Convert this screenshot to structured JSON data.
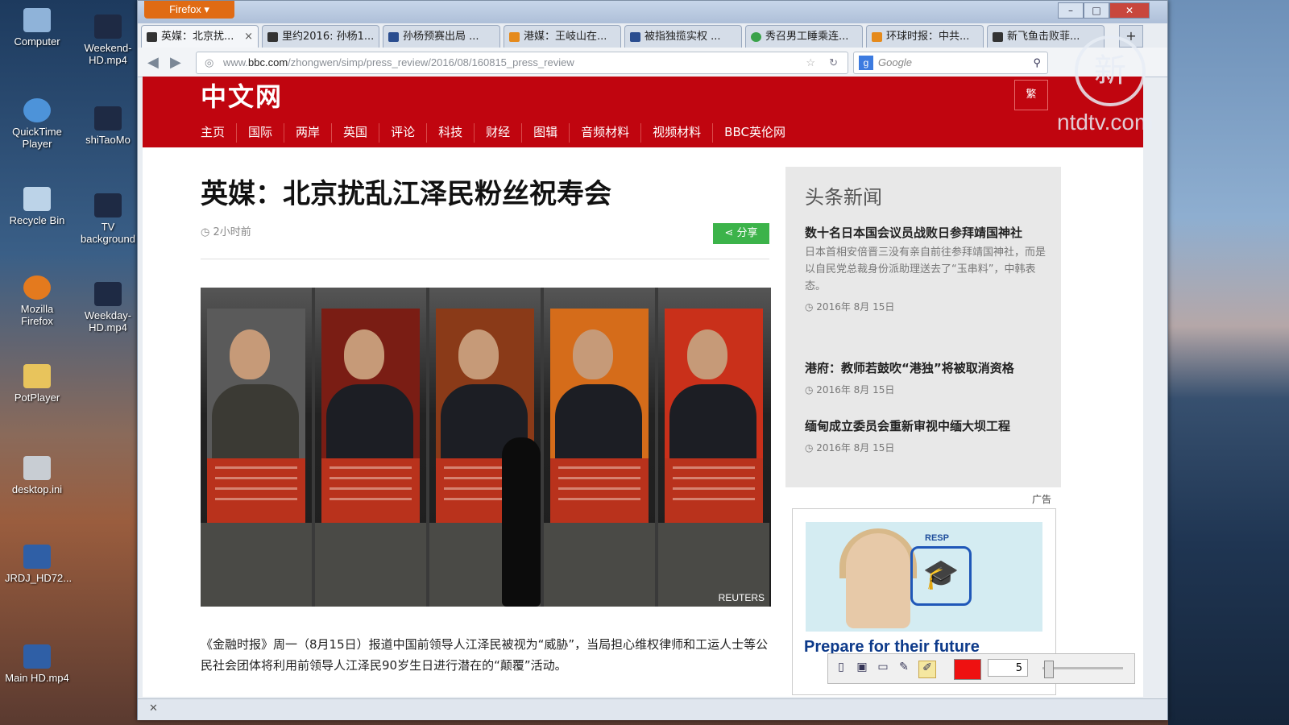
{
  "desktop": {
    "icons": [
      {
        "label": "Computer"
      },
      {
        "label": "Weekend-HD.mp4"
      },
      {
        "label": "QuickTime Player"
      },
      {
        "label": "shiTaoMo"
      },
      {
        "label": "Recycle Bin"
      },
      {
        "label": "TV background"
      },
      {
        "label": "Mozilla Firefox"
      },
      {
        "label": "Weekday-HD.mp4"
      },
      {
        "label": "PotPlayer"
      },
      {
        "label": "desktop.ini"
      },
      {
        "label": "JRDJ_HD72..."
      },
      {
        "label": "Main HD.mp4"
      }
    ]
  },
  "browser": {
    "menu_button": "Firefox ▾",
    "tabs": [
      {
        "label": "英媒：北京扰..."
      },
      {
        "label": "里约2016: 孙杨1..."
      },
      {
        "label": "孙杨预赛出局 ..."
      },
      {
        "label": "港媒：王岐山在..."
      },
      {
        "label": "被指独揽实权 ..."
      },
      {
        "label": "秀召男工睡乘连..."
      },
      {
        "label": "环球时报：中共..."
      },
      {
        "label": "新飞鱼击败菲..."
      }
    ],
    "new_tab": "+",
    "url_prefix": "www.",
    "url_host": "bbc.com",
    "url_path": "/zhongwen/simp/press_review/2016/08/160815_press_review",
    "search_placeholder": "Google"
  },
  "page": {
    "logo": "中文网",
    "trad_button": "繁",
    "menu": [
      "主页",
      "国际",
      "两岸",
      "英国",
      "评论",
      "科技",
      "财经",
      "图辑",
      "音频材料",
      "视频材料",
      "BBC英伦网"
    ],
    "headline": "英媒：北京扰乱江泽民粉丝祝寿会",
    "time_ago": "2小时前",
    "share_label": "分享",
    "photo_credit": "REUTERS",
    "body_text": "《金融时报》周一（8月15日）报道中国前领导人江泽民被视为“威胁”，当局担心维权律师和工运人士等公民社会团体将利用前领导人江泽民90岁生日进行潜在的“颠覆”活动。"
  },
  "sidebar": {
    "title": "头条新闻",
    "items": [
      {
        "title": "数十名日本国会议员战败日参拜靖国神社",
        "summary": "日本首相安倍晋三没有亲自前往参拜靖国神社，而是以自民党总裁身份派助理送去了“玉串料”，中韩表态。",
        "date": "2016年 8月 15日"
      },
      {
        "title": "港府：教师若鼓吹“港独”将被取消资格",
        "date": "2016年 8月 15日"
      },
      {
        "title": "缅甸成立委员会重新审视中缅大坝工程",
        "date": "2016年 8月 15日"
      }
    ]
  },
  "ad": {
    "label": "广告",
    "brand": "RESP",
    "text": "Prepare for their future"
  },
  "draw_tools": {
    "size": "5",
    "color": "#e11111"
  },
  "watermark": {
    "logo": "新",
    "text": "ntdtv.com"
  }
}
